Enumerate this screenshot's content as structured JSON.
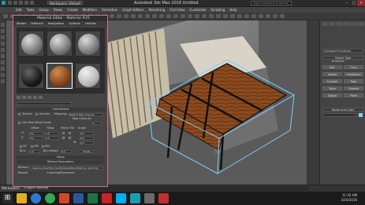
{
  "titlebar": {
    "title": "Autodesk 3ds Max 2016    Untitled",
    "workspace": "Workspace: Default",
    "search_placeholder": "Type a keyword or phrase"
  },
  "menubar": {
    "items": [
      "Edit",
      "Tools",
      "Group",
      "Views",
      "Create",
      "Modifiers",
      "Animation",
      "Graph Editors",
      "Rendering",
      "Civil View",
      "Customize",
      "Scripting",
      "Help"
    ]
  },
  "material_editor": {
    "title": "Material Editor - Material #25",
    "menu": [
      "Modes",
      "Material",
      "Navigation",
      "Options",
      "Utilities"
    ],
    "coordinates_header": "Coordinates",
    "texture_label": "Texture",
    "environ_label": "Environ",
    "mapping_label": "Mapping:",
    "mapping_value": "Explicit Map Channel",
    "map_channel_label": "Map Channel:",
    "map_channel_value": "1",
    "use_real_world": "Use Real-World Scale",
    "offset_label": "Offset",
    "tiling_label": "Tiling",
    "mirror_tile_label": "Mirror Tile",
    "angle_label": "Angle",
    "u_label": "U:",
    "v_label": "V:",
    "w_label": "W:",
    "u_offset": "0.0",
    "v_offset": "0.0",
    "u_tiling": "1.0",
    "v_tiling": "1.0",
    "u_angle": "0.0",
    "v_angle": "0.0",
    "w_angle": "0.0",
    "uv_label": "UV",
    "vw_label": "VW",
    "wu_label": "WU",
    "blur_label": "Blur:",
    "blur_value": "1.0",
    "blur_offset_label": "Blur offset:",
    "blur_offset_value": "0.0",
    "rotate_label": "Rotate",
    "noise_header": "Noise",
    "bitmap_params_header": "Bitmap Parameters",
    "bitmap_label": "Bitmap:",
    "bitmap_path": "...\\user\\sources\\3ds max\\Textures\\Wood\\texture_wood.jpg",
    "reload_label": "Reload",
    "cropping_label": "Cropping/Placement"
  },
  "command_panel": {
    "dropdown": "Standard Primitives",
    "object_type_header": "Object Type",
    "autogrid": "AutoGrid",
    "buttons": [
      "Box",
      "Cone",
      "Sphere",
      "GeoSphere",
      "Cylinder",
      "Tube",
      "Torus",
      "Pyramid",
      "Teapot",
      "Plane"
    ],
    "name_color_header": "Name and Color"
  },
  "bottom": {
    "workspace": "Workspace: Default",
    "status": "1 Object Selected"
  },
  "taskbar": {
    "time": "11:02 AM",
    "date": "3/16/2016"
  },
  "colors": {
    "accent": "#d86a88",
    "wood": "#8b4a1f",
    "selection": "#7fd0ff"
  }
}
